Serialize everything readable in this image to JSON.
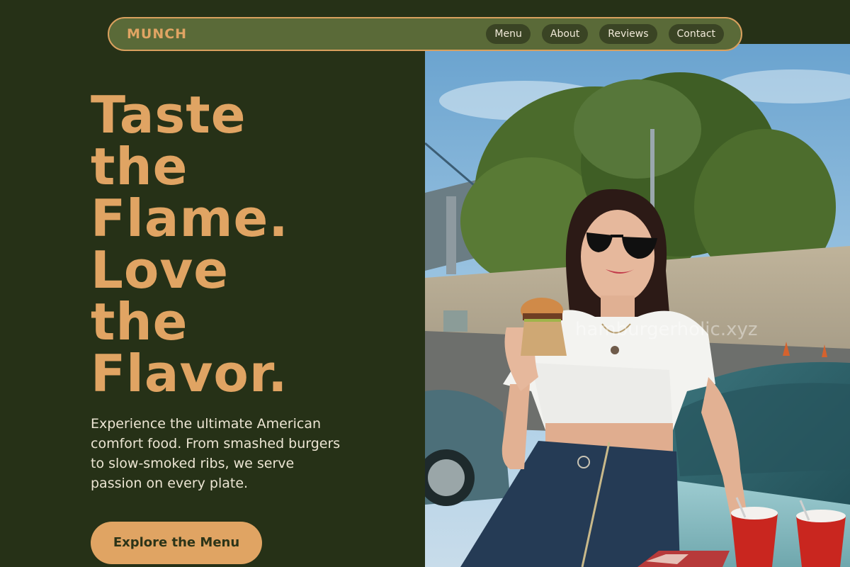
{
  "brand": "MUNCH",
  "nav": {
    "links": [
      {
        "label": "Menu"
      },
      {
        "label": "About"
      },
      {
        "label": "Reviews"
      },
      {
        "label": "Contact"
      }
    ]
  },
  "hero": {
    "headline_lines": [
      "Taste",
      "the",
      "Flame.",
      "Love",
      "the",
      "Flavor."
    ],
    "description": "Experience the ultimate American comfort food. From smashed burgers to slow-smoked ribs, we serve passion on every plate.",
    "cta_label": "Explore the Menu",
    "image_watermark": "hamburgerholic.xyz"
  },
  "colors": {
    "background": "#263117",
    "nav_background": "#5a6a38",
    "accent": "#e0a463",
    "nav_pill": "#3a4424",
    "text_light": "#ece5d3"
  }
}
